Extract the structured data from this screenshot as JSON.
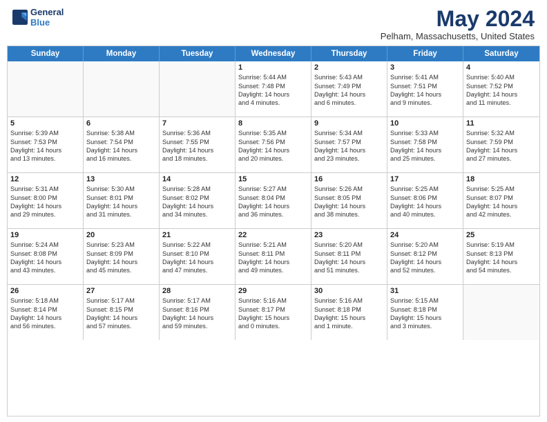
{
  "logo": {
    "line1": "General",
    "line2": "Blue"
  },
  "title": "May 2024",
  "location": "Pelham, Massachusetts, United States",
  "days_of_week": [
    "Sunday",
    "Monday",
    "Tuesday",
    "Wednesday",
    "Thursday",
    "Friday",
    "Saturday"
  ],
  "weeks": [
    [
      {
        "day": "",
        "info": ""
      },
      {
        "day": "",
        "info": ""
      },
      {
        "day": "",
        "info": ""
      },
      {
        "day": "1",
        "info": "Sunrise: 5:44 AM\nSunset: 7:48 PM\nDaylight: 14 hours\nand 4 minutes."
      },
      {
        "day": "2",
        "info": "Sunrise: 5:43 AM\nSunset: 7:49 PM\nDaylight: 14 hours\nand 6 minutes."
      },
      {
        "day": "3",
        "info": "Sunrise: 5:41 AM\nSunset: 7:51 PM\nDaylight: 14 hours\nand 9 minutes."
      },
      {
        "day": "4",
        "info": "Sunrise: 5:40 AM\nSunset: 7:52 PM\nDaylight: 14 hours\nand 11 minutes."
      }
    ],
    [
      {
        "day": "5",
        "info": "Sunrise: 5:39 AM\nSunset: 7:53 PM\nDaylight: 14 hours\nand 13 minutes."
      },
      {
        "day": "6",
        "info": "Sunrise: 5:38 AM\nSunset: 7:54 PM\nDaylight: 14 hours\nand 16 minutes."
      },
      {
        "day": "7",
        "info": "Sunrise: 5:36 AM\nSunset: 7:55 PM\nDaylight: 14 hours\nand 18 minutes."
      },
      {
        "day": "8",
        "info": "Sunrise: 5:35 AM\nSunset: 7:56 PM\nDaylight: 14 hours\nand 20 minutes."
      },
      {
        "day": "9",
        "info": "Sunrise: 5:34 AM\nSunset: 7:57 PM\nDaylight: 14 hours\nand 23 minutes."
      },
      {
        "day": "10",
        "info": "Sunrise: 5:33 AM\nSunset: 7:58 PM\nDaylight: 14 hours\nand 25 minutes."
      },
      {
        "day": "11",
        "info": "Sunrise: 5:32 AM\nSunset: 7:59 PM\nDaylight: 14 hours\nand 27 minutes."
      }
    ],
    [
      {
        "day": "12",
        "info": "Sunrise: 5:31 AM\nSunset: 8:00 PM\nDaylight: 14 hours\nand 29 minutes."
      },
      {
        "day": "13",
        "info": "Sunrise: 5:30 AM\nSunset: 8:01 PM\nDaylight: 14 hours\nand 31 minutes."
      },
      {
        "day": "14",
        "info": "Sunrise: 5:28 AM\nSunset: 8:02 PM\nDaylight: 14 hours\nand 34 minutes."
      },
      {
        "day": "15",
        "info": "Sunrise: 5:27 AM\nSunset: 8:04 PM\nDaylight: 14 hours\nand 36 minutes."
      },
      {
        "day": "16",
        "info": "Sunrise: 5:26 AM\nSunset: 8:05 PM\nDaylight: 14 hours\nand 38 minutes."
      },
      {
        "day": "17",
        "info": "Sunrise: 5:25 AM\nSunset: 8:06 PM\nDaylight: 14 hours\nand 40 minutes."
      },
      {
        "day": "18",
        "info": "Sunrise: 5:25 AM\nSunset: 8:07 PM\nDaylight: 14 hours\nand 42 minutes."
      }
    ],
    [
      {
        "day": "19",
        "info": "Sunrise: 5:24 AM\nSunset: 8:08 PM\nDaylight: 14 hours\nand 43 minutes."
      },
      {
        "day": "20",
        "info": "Sunrise: 5:23 AM\nSunset: 8:09 PM\nDaylight: 14 hours\nand 45 minutes."
      },
      {
        "day": "21",
        "info": "Sunrise: 5:22 AM\nSunset: 8:10 PM\nDaylight: 14 hours\nand 47 minutes."
      },
      {
        "day": "22",
        "info": "Sunrise: 5:21 AM\nSunset: 8:11 PM\nDaylight: 14 hours\nand 49 minutes."
      },
      {
        "day": "23",
        "info": "Sunrise: 5:20 AM\nSunset: 8:11 PM\nDaylight: 14 hours\nand 51 minutes."
      },
      {
        "day": "24",
        "info": "Sunrise: 5:20 AM\nSunset: 8:12 PM\nDaylight: 14 hours\nand 52 minutes."
      },
      {
        "day": "25",
        "info": "Sunrise: 5:19 AM\nSunset: 8:13 PM\nDaylight: 14 hours\nand 54 minutes."
      }
    ],
    [
      {
        "day": "26",
        "info": "Sunrise: 5:18 AM\nSunset: 8:14 PM\nDaylight: 14 hours\nand 56 minutes."
      },
      {
        "day": "27",
        "info": "Sunrise: 5:17 AM\nSunset: 8:15 PM\nDaylight: 14 hours\nand 57 minutes."
      },
      {
        "day": "28",
        "info": "Sunrise: 5:17 AM\nSunset: 8:16 PM\nDaylight: 14 hours\nand 59 minutes."
      },
      {
        "day": "29",
        "info": "Sunrise: 5:16 AM\nSunset: 8:17 PM\nDaylight: 15 hours\nand 0 minutes."
      },
      {
        "day": "30",
        "info": "Sunrise: 5:16 AM\nSunset: 8:18 PM\nDaylight: 15 hours\nand 1 minute."
      },
      {
        "day": "31",
        "info": "Sunrise: 5:15 AM\nSunset: 8:18 PM\nDaylight: 15 hours\nand 3 minutes."
      },
      {
        "day": "",
        "info": ""
      }
    ]
  ]
}
